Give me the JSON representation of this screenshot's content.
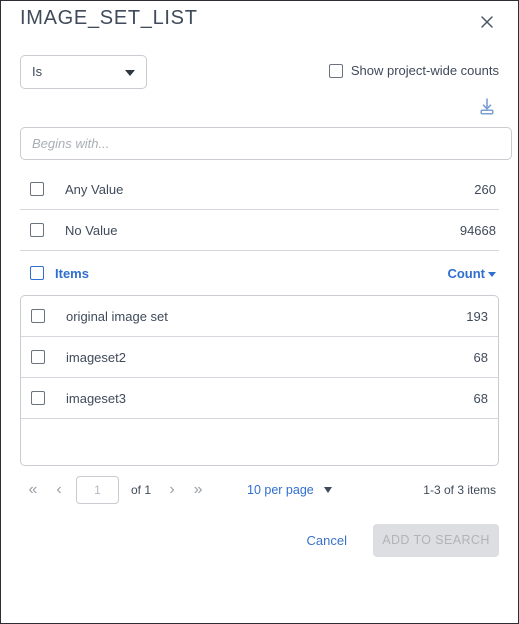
{
  "dialog": {
    "title": "IMAGE_SET_LIST",
    "close_icon": "close-icon"
  },
  "condition": {
    "operator_value": "Is",
    "operator_caret_icon": "chevron-down-icon",
    "project_wide_counts_label": "Show project-wide counts",
    "project_wide_counts_checked": false
  },
  "download": {
    "icon": "download-icon"
  },
  "search": {
    "placeholder": "Begins with...",
    "value": ""
  },
  "meta_rows": [
    {
      "label": "Any Value",
      "count": "260",
      "checked": false
    },
    {
      "label": "No Value",
      "count": "94668",
      "checked": false
    }
  ],
  "items_header": {
    "label": "Items",
    "checked": false,
    "sort_label": "Count",
    "sort_caret_icon": "caret-down-icon"
  },
  "items": [
    {
      "label": "original image set",
      "count": "193",
      "checked": false
    },
    {
      "label": "imageset2",
      "count": "68",
      "checked": false
    },
    {
      "label": "imageset3",
      "count": "68",
      "checked": false
    }
  ],
  "pagination": {
    "first_icon": "«",
    "prev_icon": "‹",
    "page_value": "1",
    "page_total": "of 1",
    "next_icon": "›",
    "last_icon": "»",
    "per_page_label": "10 per page",
    "per_page_caret_icon": "caret-down-icon",
    "range_text": "1-3 of 3 items"
  },
  "footer": {
    "cancel_label": "Cancel",
    "add_label": "ADD TO SEARCH",
    "add_disabled": true
  },
  "colors": {
    "accent_blue": "#2f6fd0",
    "link_blue": "#3b72c9",
    "text_slate": "#3f4a5a",
    "border_gray": "#c9ccd1",
    "divider_gray": "#d4d7dc",
    "disabled_bg": "#dcdee1",
    "disabled_text": "#b0b4b9"
  }
}
